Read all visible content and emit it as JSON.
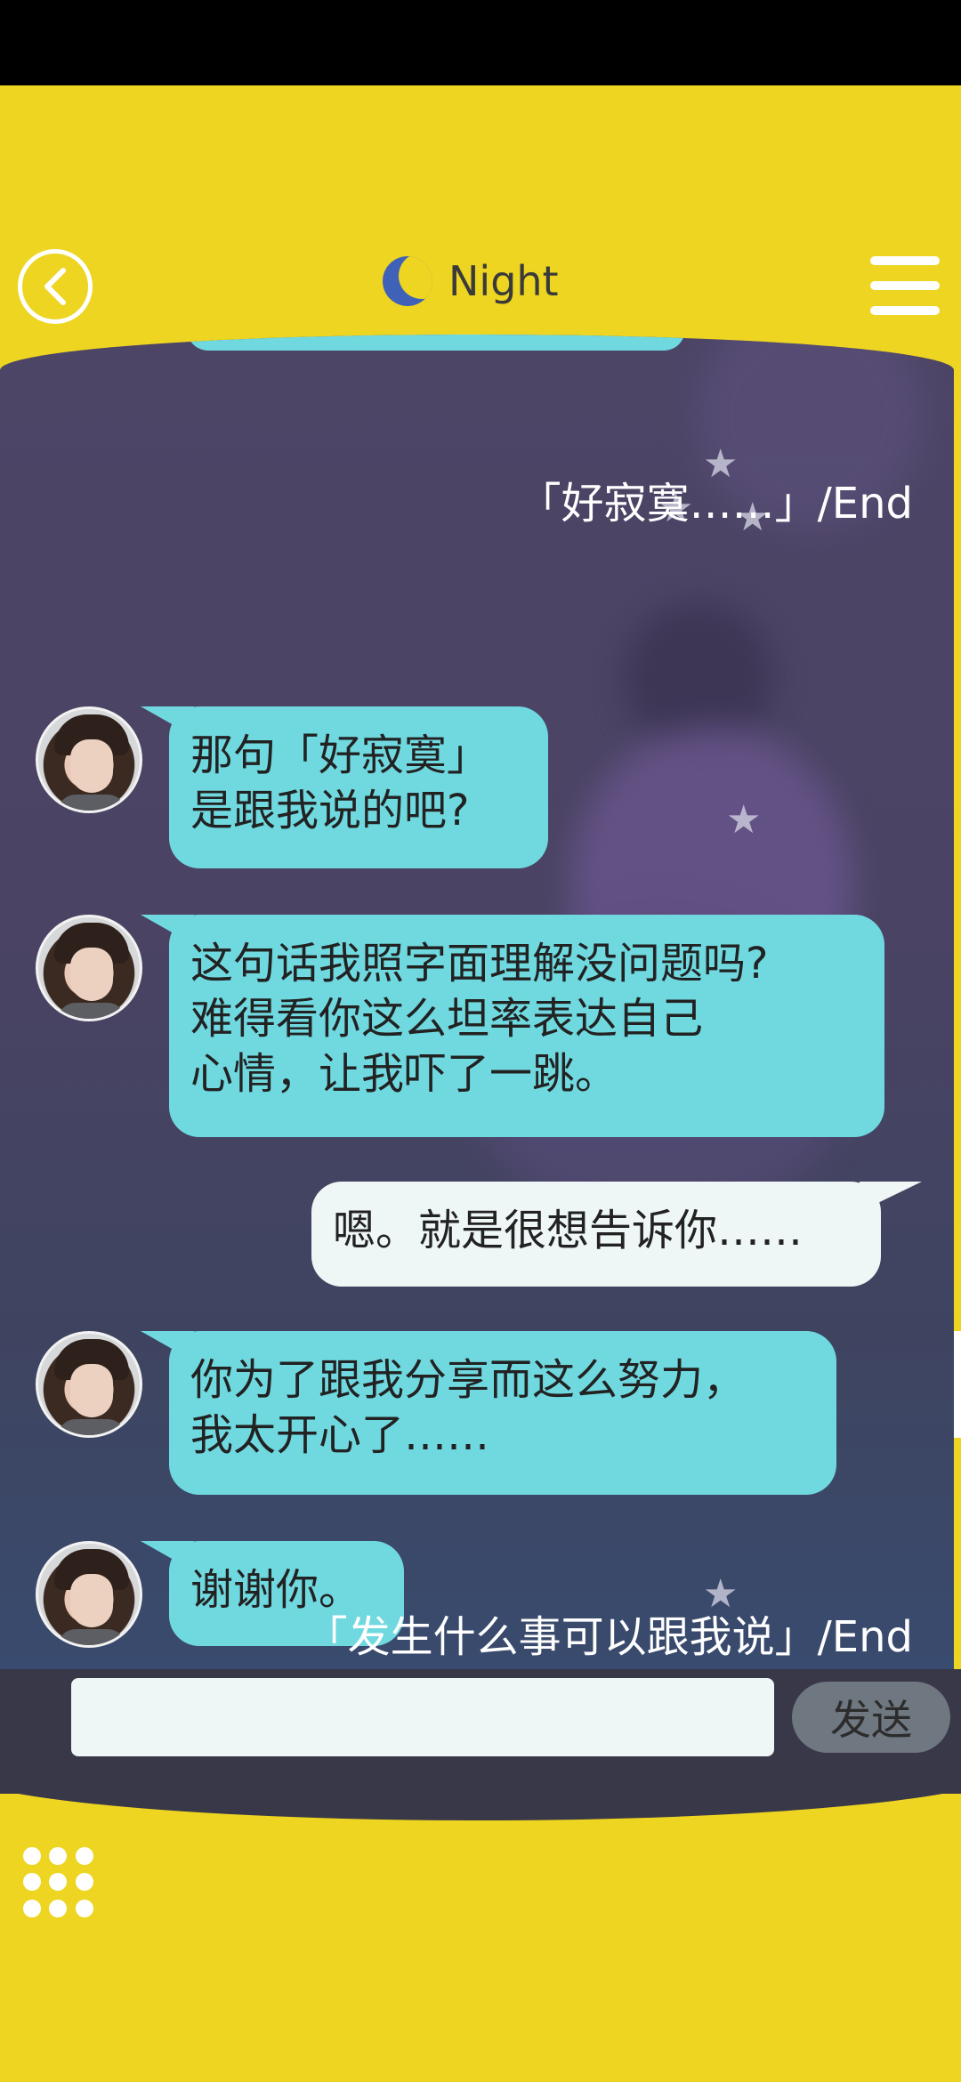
{
  "header": {
    "title": "Night",
    "icons": {
      "back": "chevron-left-icon",
      "moon": "moon-icon",
      "menu": "menu-icon"
    }
  },
  "messages": [
    {
      "type": "end",
      "text": "「好寂寞……」/End"
    },
    {
      "type": "left",
      "text": "那句「好寂寞」\n是跟我说的吧?"
    },
    {
      "type": "left",
      "text": "这句话我照字面理解没问题吗?\n难得看你这么坦率表达自己\n心情，让我吓了一跳。"
    },
    {
      "type": "right",
      "text": "嗯。就是很想告诉你……"
    },
    {
      "type": "left",
      "text": "你为了跟我分享而这么努力，\n我太开心了……"
    },
    {
      "type": "left",
      "text": "谢谢你。"
    },
    {
      "type": "end",
      "text": "「发生什么事可以跟我说」/End"
    }
  ],
  "composer": {
    "placeholder": "",
    "send_label": "发送"
  },
  "colors": {
    "frame": "#EDD521",
    "bubble_left": "#70D9E0",
    "bubble_right": "#EEF6F6",
    "composer_bg": "#393849"
  }
}
